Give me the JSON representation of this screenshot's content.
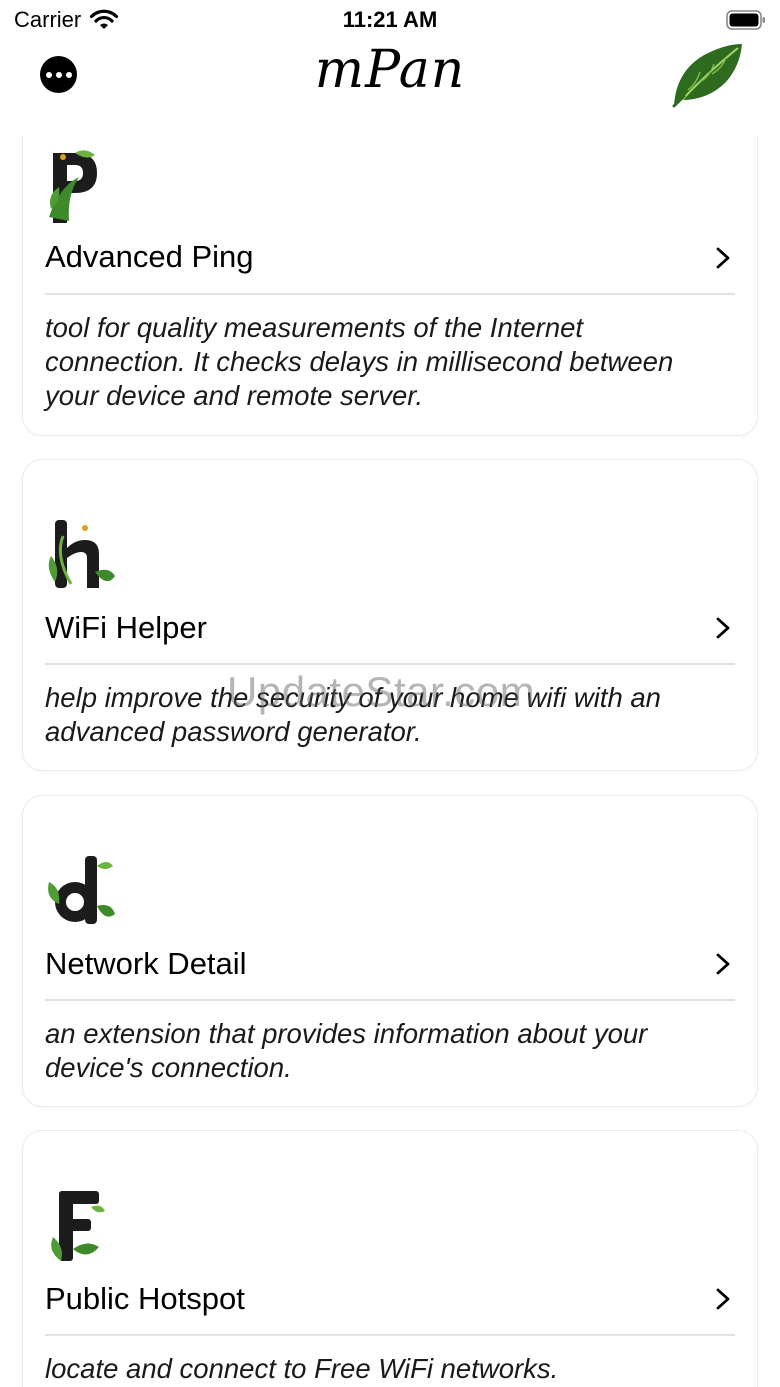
{
  "status_bar": {
    "carrier": "Carrier",
    "time": "11:21 AM"
  },
  "nav": {
    "title": "mPan",
    "more_icon": "ellipsis-circle-icon",
    "brand_icon": "leaf-icon"
  },
  "tools": [
    {
      "letter": "P",
      "title": "Advanced Ping",
      "description": "tool for quality measurements of the Internet connection. It checks delays in millisecond between your device and remote server."
    },
    {
      "letter": "h",
      "title": "WiFi Helper",
      "description": "help improve the security of your home wifi with an advanced password generator."
    },
    {
      "letter": "d",
      "title": "Network Detail",
      "description": "an extension that provides information about your device's connection."
    },
    {
      "letter": "F",
      "title": "Public Hotspot",
      "description": "locate and connect to Free WiFi networks."
    }
  ],
  "watermark": "UpdateStar.com",
  "colors": {
    "leaf_dark": "#2f6b1f",
    "leaf_light": "#6db33f",
    "letter_dark": "#1c1c1c",
    "card_border": "#ececec",
    "divider": "#e2e2e2"
  }
}
